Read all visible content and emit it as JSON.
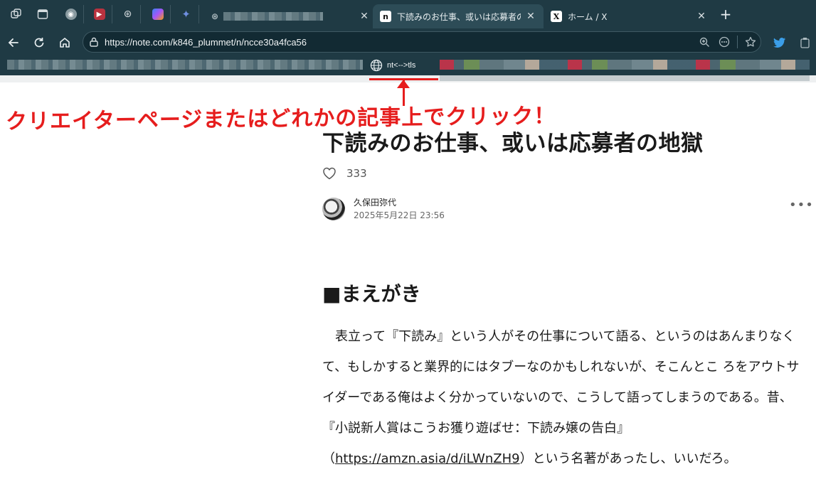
{
  "browser": {
    "tabs": [
      {
        "label": "下読みのお仕事、或いは応募者の地獄",
        "favicon": "n",
        "active": true
      },
      {
        "label": "ホーム / X",
        "favicon": "X",
        "active": false
      }
    ],
    "close_glyph": "✕",
    "newtab_glyph": "+",
    "url": "https://note.com/k846_plummet/n/ncce30a4fca56",
    "bookmark": {
      "label": "nt<-->tls"
    }
  },
  "annotation": {
    "text": "クリエイターページまたはどれかの記事上でクリック！",
    "color": "#e61d1d"
  },
  "article": {
    "title": "下読みのお仕事、或いは応募者の地獄",
    "likes": "333",
    "author": {
      "name": "久保田弥代",
      "date": "2025年5月22日 23:56"
    },
    "more": "•••",
    "section_heading": "■まえがき",
    "body_before_link": "表立って『下読み』という人がその仕事について語る、というのはあんまりなくて、もしかすると業界的にはタブーなのかもしれないが、そこんとこ ろをアウトサイダーである俺はよく分かっていないので、こうして語ってしまうのである。昔、『小説新人賞はこうお獲り遊ばせ：下読み嬢の告白』（",
    "link": "https://amzn.asia/d/iLWnZH9",
    "body_after_link": "）という名著があったし、いいだろ。"
  },
  "colors": {
    "chrome": "#1f3a44",
    "active_tab": "#2d4c57",
    "accent_red": "#e61d1d"
  }
}
